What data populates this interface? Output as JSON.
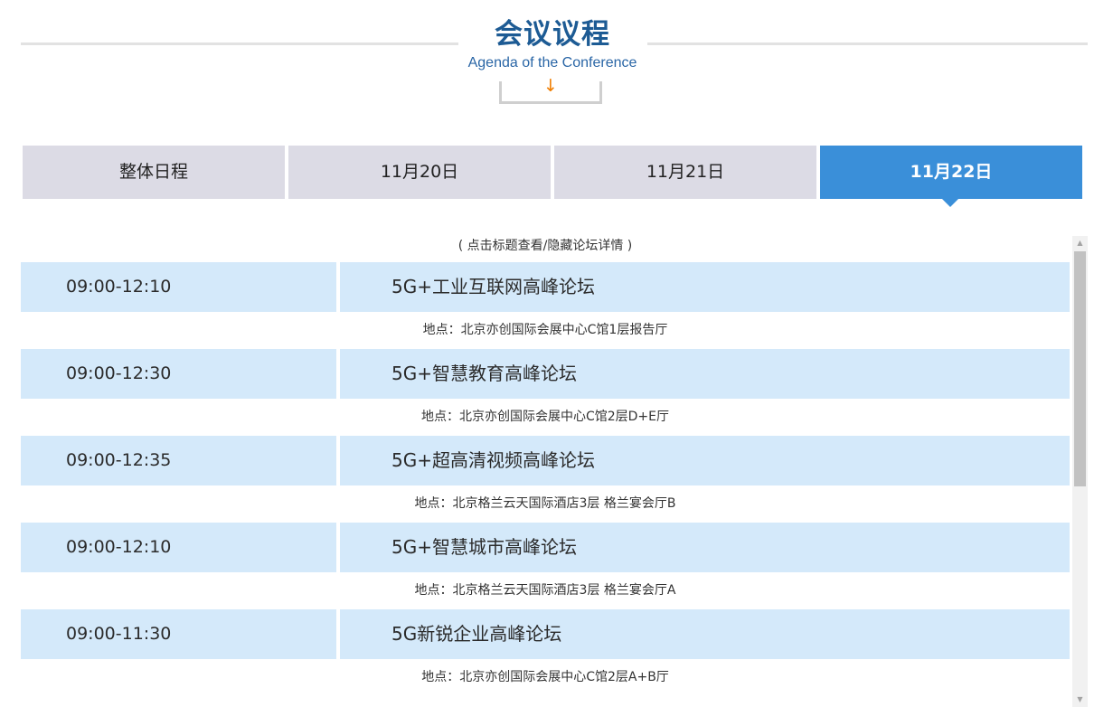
{
  "header": {
    "title": "会议议程",
    "subtitle": "Agenda of the Conference",
    "arrow_icon": "↓"
  },
  "tabs": [
    {
      "label": "整体日程",
      "active": false
    },
    {
      "label": "11月20日",
      "active": false
    },
    {
      "label": "11月21日",
      "active": false
    },
    {
      "label": "11月22日",
      "active": true
    }
  ],
  "hint": "( 点击标题查看/隐藏论坛详情 )",
  "sessions": [
    {
      "time": "09:00-12:10",
      "title": "5G+工业互联网高峰论坛",
      "venue": "地点：北京亦创国际会展中心C馆1层报告厅"
    },
    {
      "time": "09:00-12:30",
      "title": "5G+智慧教育高峰论坛",
      "venue": "地点：北京亦创国际会展中心C馆2层D+E厅"
    },
    {
      "time": "09:00-12:35",
      "title": "5G+超高清视频高峰论坛",
      "venue": "地点：北京格兰云天国际酒店3层 格兰宴会厅B"
    },
    {
      "time": "09:00-12:10",
      "title": "5G+智慧城市高峰论坛",
      "venue": "地点：北京格兰云天国际酒店3层 格兰宴会厅A"
    },
    {
      "time": "09:00-11:30",
      "title": "5G新锐企业高峰论坛",
      "venue": "地点：北京亦创国际会展中心C馆2层A+B厅"
    }
  ],
  "colors": {
    "title": "#1d5b94",
    "accent": "#3a8fd9",
    "arrow": "#f07d00",
    "tab_inactive": "#dcdbe5",
    "row_background": "#d4e9fa"
  },
  "scrollbar": {
    "up_icon": "▲",
    "down_icon": "▼"
  }
}
